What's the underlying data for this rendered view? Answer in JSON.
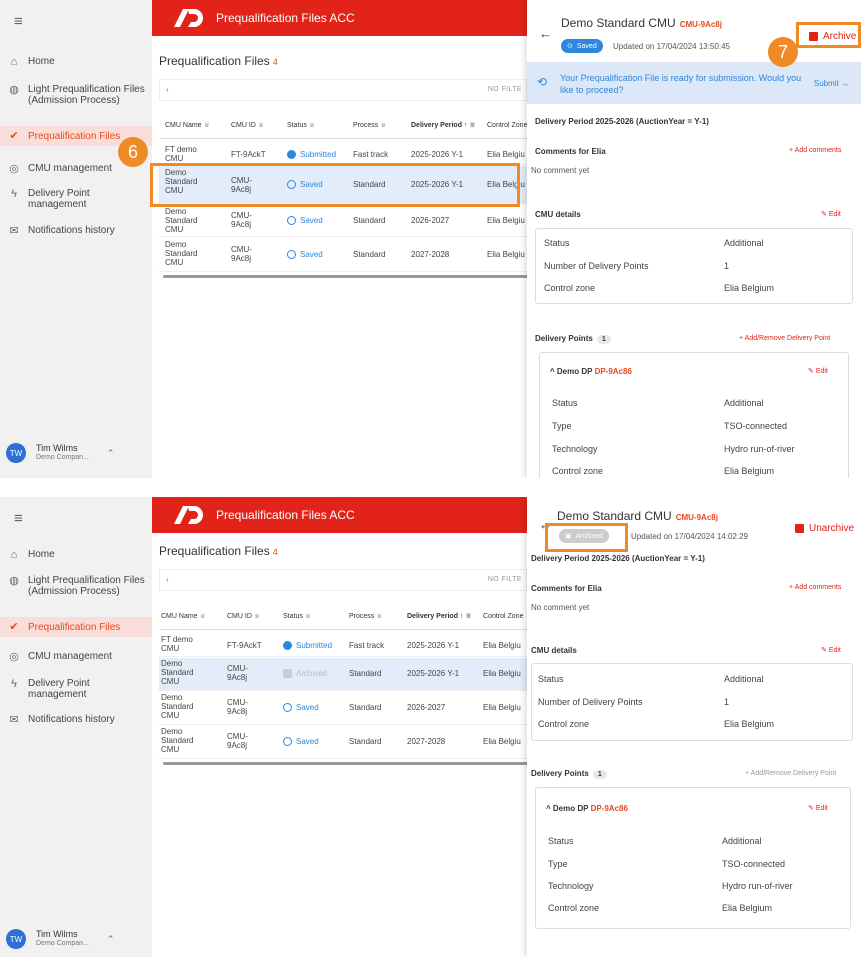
{
  "nav": {
    "menu_icon": "menu-icon",
    "items": [
      {
        "label": "Home",
        "icon": "home-icon"
      },
      {
        "label": "Light Prequalification Files (Admission Process)",
        "icon": "globe-icon"
      },
      {
        "label": "Prequalification Files",
        "icon": "check-badge-icon"
      },
      {
        "label": "CMU management",
        "icon": "cmu-icon"
      },
      {
        "label": "Delivery Point management",
        "icon": "bolt-icon"
      },
      {
        "label": "Notifications history",
        "icon": "mail-icon"
      }
    ],
    "user": {
      "initials": "TW",
      "name": "Tim Wilms",
      "company": "Demo Compan..."
    }
  },
  "app": {
    "title": "Prequalification Files ACC"
  },
  "page": {
    "title": "Prequalification Files",
    "count": "4",
    "no_filter": "NO FILTE"
  },
  "table": {
    "headers": [
      "CMU Name",
      "CMU ID",
      "Status",
      "Process",
      "Delivery Period ↑",
      "Control Zone"
    ],
    "rows1": [
      {
        "name": "FT demo CMU",
        "id": "FT-9AckT",
        "status": "Submitted",
        "process": "Fast track",
        "period": "2025-2026",
        "year": "Y-1",
        "zone": "Elia Belgiu"
      },
      {
        "name": "Demo Standard CMU",
        "id": "CMU-9Ac8j",
        "status": "Saved",
        "process": "Standard",
        "period": "2025-2026",
        "year": "Y-1",
        "zone": "Elia Belgiu"
      },
      {
        "name": "Demo Standard CMU",
        "id": "CMU-9Ac8j",
        "status": "Saved",
        "process": "Standard",
        "period": "2026-2027",
        "year": "",
        "zone": "Elia Belgiu"
      },
      {
        "name": "Demo Standard CMU",
        "id": "CMU-9Ac8j",
        "status": "Saved",
        "process": "Standard",
        "period": "2027-2028",
        "year": "",
        "zone": "Elia Belgiu"
      }
    ],
    "rows2": [
      {
        "name": "FT demo CMU",
        "id": "FT-9AckT",
        "status": "Submitted",
        "process": "Fast track",
        "period": "2025-2026",
        "year": "Y-1",
        "zone": "Elia Belgiu"
      },
      {
        "name": "Demo Standard CMU",
        "id": "CMU-9Ac8j",
        "status": "Archived",
        "process": "Standard",
        "period": "2025-2026",
        "year": "Y-1",
        "zone": "Elia Belgiu"
      },
      {
        "name": "Demo Standard CMU",
        "id": "CMU-9Ac8j",
        "status": "Saved",
        "process": "Standard",
        "period": "2026-2027",
        "year": "",
        "zone": "Elia Belgiu"
      },
      {
        "name": "Demo Standard CMU",
        "id": "CMU-9Ac8j",
        "status": "Saved",
        "process": "Standard",
        "period": "2027-2028",
        "year": "",
        "zone": "Elia Belgiu"
      }
    ]
  },
  "drawer1": {
    "title": "Demo Standard CMU",
    "code": "CMU-9Ac8j",
    "pill": "Saved",
    "updated": "Updated on 17/04/2024 13:50:45",
    "action": "Archive",
    "banner_text": "Your Prequalification File is ready for submission. Would you like to proceed?",
    "banner_action": "Submit →",
    "period_line": "Delivery Period 2025-2026 (AuctionYear = Y-1)"
  },
  "drawer2": {
    "title": "Demo Standard CMU",
    "code": "CMU-9Ac8j",
    "pill": "Archived",
    "updated": "Updated on 17/04/2024 14:02:29",
    "action": "Unarchive",
    "period_line": "Delivery Period 2025-2026 (AuctionYear = Y-1)"
  },
  "details": {
    "comments_title": "Comments for Elia",
    "add_comments": "+ Add comments",
    "no_comment": "No comment yet",
    "cmu_title": "CMU details",
    "edit": "Edit",
    "cmu_rows": [
      {
        "k": "Status",
        "v": "Additional"
      },
      {
        "k": "Number of Delivery Points",
        "v": "1"
      },
      {
        "k": "Control zone",
        "v": "Elia Belgium"
      }
    ],
    "dp_title": "Delivery Points",
    "dp_count": "1",
    "dp_action": "+ Add/Remove Delivery Point",
    "dp_name": "Demo DP",
    "dp_code": "DP-9Ac86",
    "dp_rows": [
      {
        "k": "Status",
        "v": "Additional"
      },
      {
        "k": "Type",
        "v": "TSO-connected"
      },
      {
        "k": "Technology",
        "v": "Hydro run-of-river"
      },
      {
        "k": "Control zone",
        "v": "Elia Belgium"
      }
    ]
  },
  "callouts": {
    "step6": "6",
    "step7": "7"
  },
  "colors": {
    "brand": "#e2231a",
    "accent": "#2e86de",
    "callout": "#f08a24"
  }
}
